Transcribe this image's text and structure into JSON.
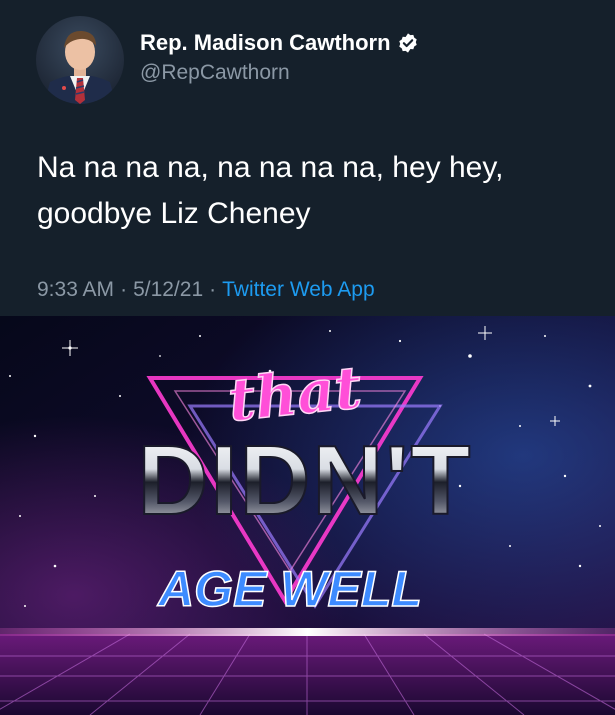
{
  "tweet": {
    "display_name": "Rep. Madison Cawthorn",
    "handle": "@RepCawthorn",
    "text_line1": "Na na na na, na na na na, hey hey,",
    "text_line2": "goodbye Liz Cheney",
    "time": "9:33 AM",
    "separator": "·",
    "date": "5/12/21",
    "source": "Twitter Web App"
  },
  "meme": {
    "word_that": "that",
    "word_didnt": "DIDN'T",
    "word_agewell": "AGE WELL"
  },
  "colors": {
    "background": "#15202b",
    "text_primary": "#ffffff",
    "text_secondary": "#8b98a5",
    "link": "#1d9bf0",
    "verified": "#ffffff"
  }
}
